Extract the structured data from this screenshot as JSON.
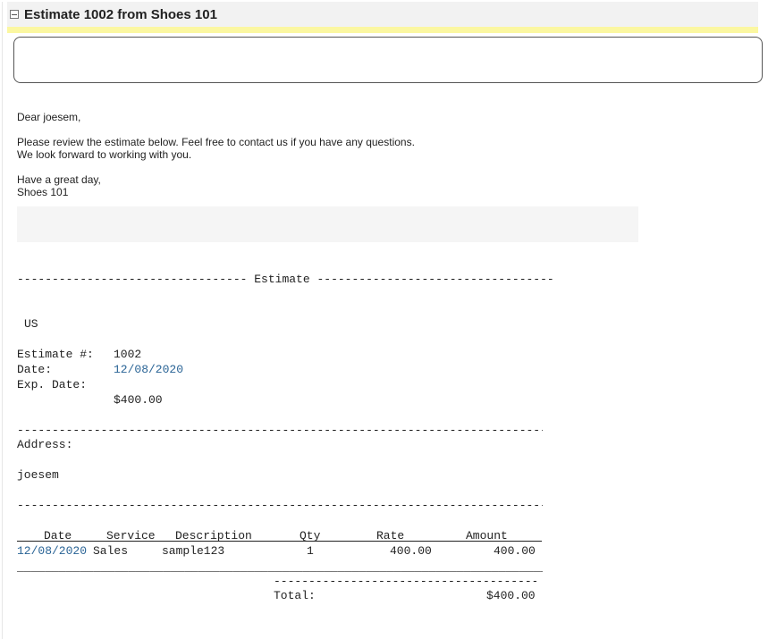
{
  "header": {
    "collapse_icon": "minus-square-icon",
    "title": "Estimate 1002 from Shoes 101"
  },
  "email": {
    "greeting": "Dear joesem,",
    "body_line1": "Please review the estimate below. Feel free to contact us if you have any questions.",
    "body_line2": "We look forward to working with you.",
    "closing": "Have a great day,",
    "signature": "Shoes 101"
  },
  "estimate": {
    "section_title": " Estimate ",
    "country": "US",
    "number_label": "Estimate #:",
    "number": "1002",
    "date_label": "Date:",
    "date": "12/08/2020",
    "exp_date_label": "Exp. Date:",
    "exp_date": "",
    "total_top": "$400.00",
    "address_label": "Address:",
    "address_name": "joesem",
    "table_headers": {
      "date": "Date",
      "service": "Service",
      "description": "Description",
      "qty": "Qty",
      "rate": "Rate",
      "amount": "Amount"
    },
    "line_item": {
      "date": "12/08/2020",
      "service": "Sales",
      "description": "sample123",
      "qty": "1",
      "rate": "400.00",
      "amount": "400.00"
    },
    "total_label": "Total:",
    "total_value": "$400.00"
  },
  "separators": {
    "left_dashes": "---------------------------------",
    "right_dashes": "----------------------------------",
    "full_dashes": "-----------------------------------------------------------------------------",
    "full_underscores": "_____________________________________________________________________________",
    "total_dashes": "----------------------------------------"
  },
  "colors": {
    "header_bg": "#f2f2f2",
    "highlight_bar": "#fbf7a1",
    "link": "#2a6496"
  }
}
